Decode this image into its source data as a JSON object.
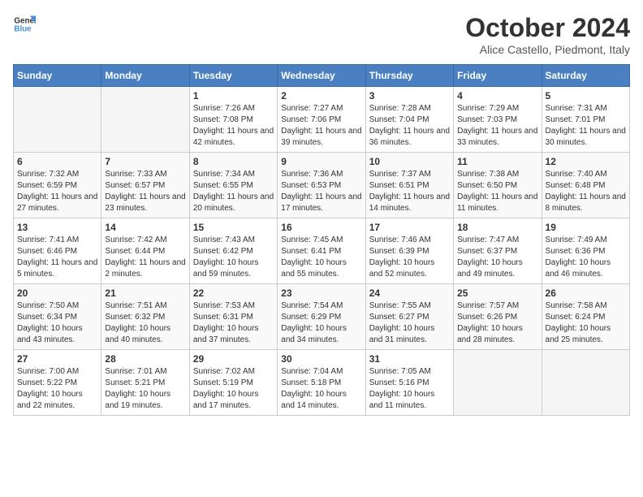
{
  "header": {
    "logo_general": "General",
    "logo_blue": "Blue",
    "title": "October 2024",
    "subtitle": "Alice Castello, Piedmont, Italy"
  },
  "calendar": {
    "days_of_week": [
      "Sunday",
      "Monday",
      "Tuesday",
      "Wednesday",
      "Thursday",
      "Friday",
      "Saturday"
    ],
    "weeks": [
      [
        {
          "day": "",
          "info": ""
        },
        {
          "day": "",
          "info": ""
        },
        {
          "day": "1",
          "info": "Sunrise: 7:26 AM\nSunset: 7:08 PM\nDaylight: 11 hours and 42 minutes."
        },
        {
          "day": "2",
          "info": "Sunrise: 7:27 AM\nSunset: 7:06 PM\nDaylight: 11 hours and 39 minutes."
        },
        {
          "day": "3",
          "info": "Sunrise: 7:28 AM\nSunset: 7:04 PM\nDaylight: 11 hours and 36 minutes."
        },
        {
          "day": "4",
          "info": "Sunrise: 7:29 AM\nSunset: 7:03 PM\nDaylight: 11 hours and 33 minutes."
        },
        {
          "day": "5",
          "info": "Sunrise: 7:31 AM\nSunset: 7:01 PM\nDaylight: 11 hours and 30 minutes."
        }
      ],
      [
        {
          "day": "6",
          "info": "Sunrise: 7:32 AM\nSunset: 6:59 PM\nDaylight: 11 hours and 27 minutes."
        },
        {
          "day": "7",
          "info": "Sunrise: 7:33 AM\nSunset: 6:57 PM\nDaylight: 11 hours and 23 minutes."
        },
        {
          "day": "8",
          "info": "Sunrise: 7:34 AM\nSunset: 6:55 PM\nDaylight: 11 hours and 20 minutes."
        },
        {
          "day": "9",
          "info": "Sunrise: 7:36 AM\nSunset: 6:53 PM\nDaylight: 11 hours and 17 minutes."
        },
        {
          "day": "10",
          "info": "Sunrise: 7:37 AM\nSunset: 6:51 PM\nDaylight: 11 hours and 14 minutes."
        },
        {
          "day": "11",
          "info": "Sunrise: 7:38 AM\nSunset: 6:50 PM\nDaylight: 11 hours and 11 minutes."
        },
        {
          "day": "12",
          "info": "Sunrise: 7:40 AM\nSunset: 6:48 PM\nDaylight: 11 hours and 8 minutes."
        }
      ],
      [
        {
          "day": "13",
          "info": "Sunrise: 7:41 AM\nSunset: 6:46 PM\nDaylight: 11 hours and 5 minutes."
        },
        {
          "day": "14",
          "info": "Sunrise: 7:42 AM\nSunset: 6:44 PM\nDaylight: 11 hours and 2 minutes."
        },
        {
          "day": "15",
          "info": "Sunrise: 7:43 AM\nSunset: 6:42 PM\nDaylight: 10 hours and 59 minutes."
        },
        {
          "day": "16",
          "info": "Sunrise: 7:45 AM\nSunset: 6:41 PM\nDaylight: 10 hours and 55 minutes."
        },
        {
          "day": "17",
          "info": "Sunrise: 7:46 AM\nSunset: 6:39 PM\nDaylight: 10 hours and 52 minutes."
        },
        {
          "day": "18",
          "info": "Sunrise: 7:47 AM\nSunset: 6:37 PM\nDaylight: 10 hours and 49 minutes."
        },
        {
          "day": "19",
          "info": "Sunrise: 7:49 AM\nSunset: 6:36 PM\nDaylight: 10 hours and 46 minutes."
        }
      ],
      [
        {
          "day": "20",
          "info": "Sunrise: 7:50 AM\nSunset: 6:34 PM\nDaylight: 10 hours and 43 minutes."
        },
        {
          "day": "21",
          "info": "Sunrise: 7:51 AM\nSunset: 6:32 PM\nDaylight: 10 hours and 40 minutes."
        },
        {
          "day": "22",
          "info": "Sunrise: 7:53 AM\nSunset: 6:31 PM\nDaylight: 10 hours and 37 minutes."
        },
        {
          "day": "23",
          "info": "Sunrise: 7:54 AM\nSunset: 6:29 PM\nDaylight: 10 hours and 34 minutes."
        },
        {
          "day": "24",
          "info": "Sunrise: 7:55 AM\nSunset: 6:27 PM\nDaylight: 10 hours and 31 minutes."
        },
        {
          "day": "25",
          "info": "Sunrise: 7:57 AM\nSunset: 6:26 PM\nDaylight: 10 hours and 28 minutes."
        },
        {
          "day": "26",
          "info": "Sunrise: 7:58 AM\nSunset: 6:24 PM\nDaylight: 10 hours and 25 minutes."
        }
      ],
      [
        {
          "day": "27",
          "info": "Sunrise: 7:00 AM\nSunset: 5:22 PM\nDaylight: 10 hours and 22 minutes."
        },
        {
          "day": "28",
          "info": "Sunrise: 7:01 AM\nSunset: 5:21 PM\nDaylight: 10 hours and 19 minutes."
        },
        {
          "day": "29",
          "info": "Sunrise: 7:02 AM\nSunset: 5:19 PM\nDaylight: 10 hours and 17 minutes."
        },
        {
          "day": "30",
          "info": "Sunrise: 7:04 AM\nSunset: 5:18 PM\nDaylight: 10 hours and 14 minutes."
        },
        {
          "day": "31",
          "info": "Sunrise: 7:05 AM\nSunset: 5:16 PM\nDaylight: 10 hours and 11 minutes."
        },
        {
          "day": "",
          "info": ""
        },
        {
          "day": "",
          "info": ""
        }
      ]
    ]
  }
}
